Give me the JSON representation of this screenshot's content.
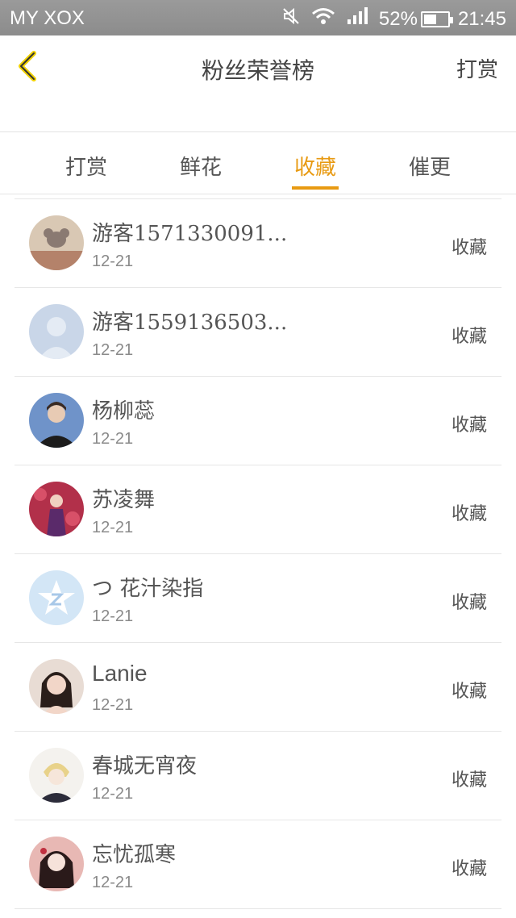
{
  "status_bar": {
    "carrier": "MY XOX",
    "battery": "52%",
    "time": "21:45",
    "icons": [
      "mute-icon",
      "wifi-icon",
      "signal-icon",
      "battery-icon"
    ]
  },
  "header": {
    "title": "粉丝荣誉榜",
    "right_action": "打赏"
  },
  "tabs": [
    {
      "label": "打赏",
      "active": false
    },
    {
      "label": "鲜花",
      "active": false
    },
    {
      "label": "收藏",
      "active": true
    },
    {
      "label": "催更",
      "active": false
    }
  ],
  "accent_color": "#e89a12",
  "list": [
    {
      "name": "游客1571330091...",
      "date": "12-21",
      "action": "收藏",
      "avatar": "mouse-avatar"
    },
    {
      "name": "游客1559136503...",
      "date": "12-21",
      "action": "收藏",
      "avatar": "default-avatar"
    },
    {
      "name": "杨柳蕊",
      "date": "12-21",
      "action": "收藏",
      "avatar": "photo-avatar"
    },
    {
      "name": "苏凌舞",
      "date": "12-21",
      "action": "收藏",
      "avatar": "photo-avatar"
    },
    {
      "name": "つ 花汁染指",
      "date": "12-21",
      "action": "收藏",
      "avatar": "star-avatar"
    },
    {
      "name": "Lanie",
      "date": "12-21",
      "action": "收藏",
      "avatar": "photo-avatar"
    },
    {
      "name": "春城无宵夜",
      "date": "12-21",
      "action": "收藏",
      "avatar": "anime-avatar"
    },
    {
      "name": "忘忧孤寒",
      "date": "12-21",
      "action": "收藏",
      "avatar": "anime-avatar"
    }
  ]
}
